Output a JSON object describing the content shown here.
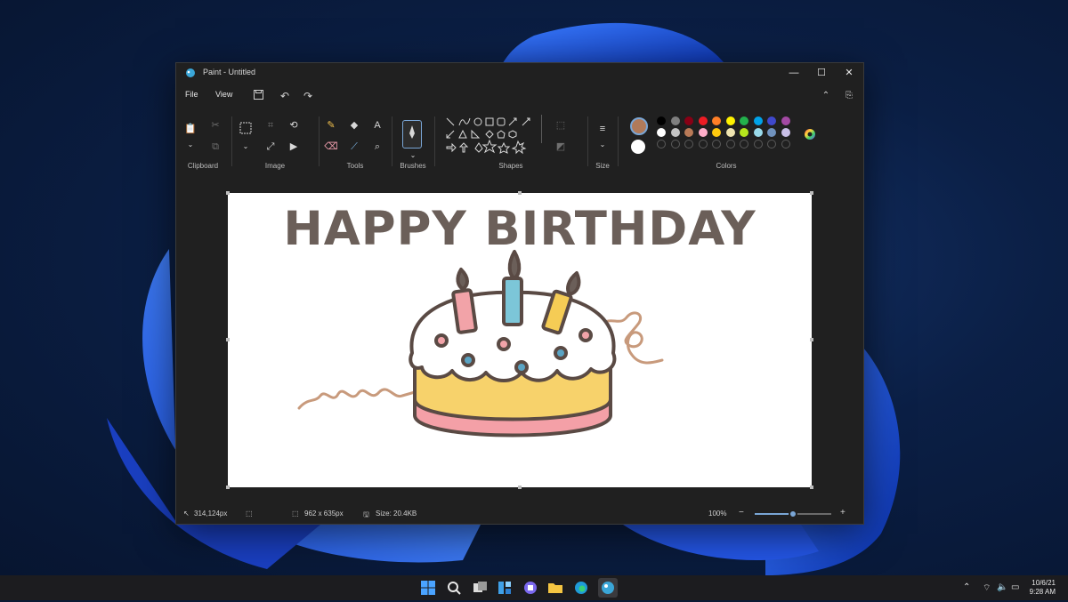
{
  "window": {
    "title": "Paint - Untitled"
  },
  "menu": {
    "file": "File",
    "view": "View"
  },
  "ribbon": {
    "groups": [
      "Clipboard",
      "Image",
      "Tools",
      "Brushes",
      "Shapes",
      "Size",
      "Colors"
    ],
    "tools_text_icon": "A"
  },
  "colors": {
    "primary": "#b07a5a",
    "secondary": "#ffffff",
    "row1": [
      "#000000",
      "#7f7f7f",
      "#880015",
      "#ed1c24",
      "#ff7f27",
      "#fff200",
      "#22b14c",
      "#00a2e8",
      "#3f48cc",
      "#a349a4"
    ],
    "row2": [
      "#ffffff",
      "#c3c3c3",
      "#b97a57",
      "#ffaec9",
      "#ffc90e",
      "#efe4b0",
      "#b5e61d",
      "#99d9ea",
      "#7092be",
      "#c8bfe7"
    ]
  },
  "canvas": {
    "text": "HAPPY BIRTHDAY"
  },
  "status": {
    "cursor": "314,124px",
    "dimensions": "962 x 635px",
    "size": "Size: 20.4KB",
    "zoom": "100%",
    "zoom_minus": "−",
    "zoom_plus": "+",
    "zoom_level": 0.5
  },
  "taskbar": {
    "time": "9:28 AM",
    "date": "10/6/21"
  }
}
